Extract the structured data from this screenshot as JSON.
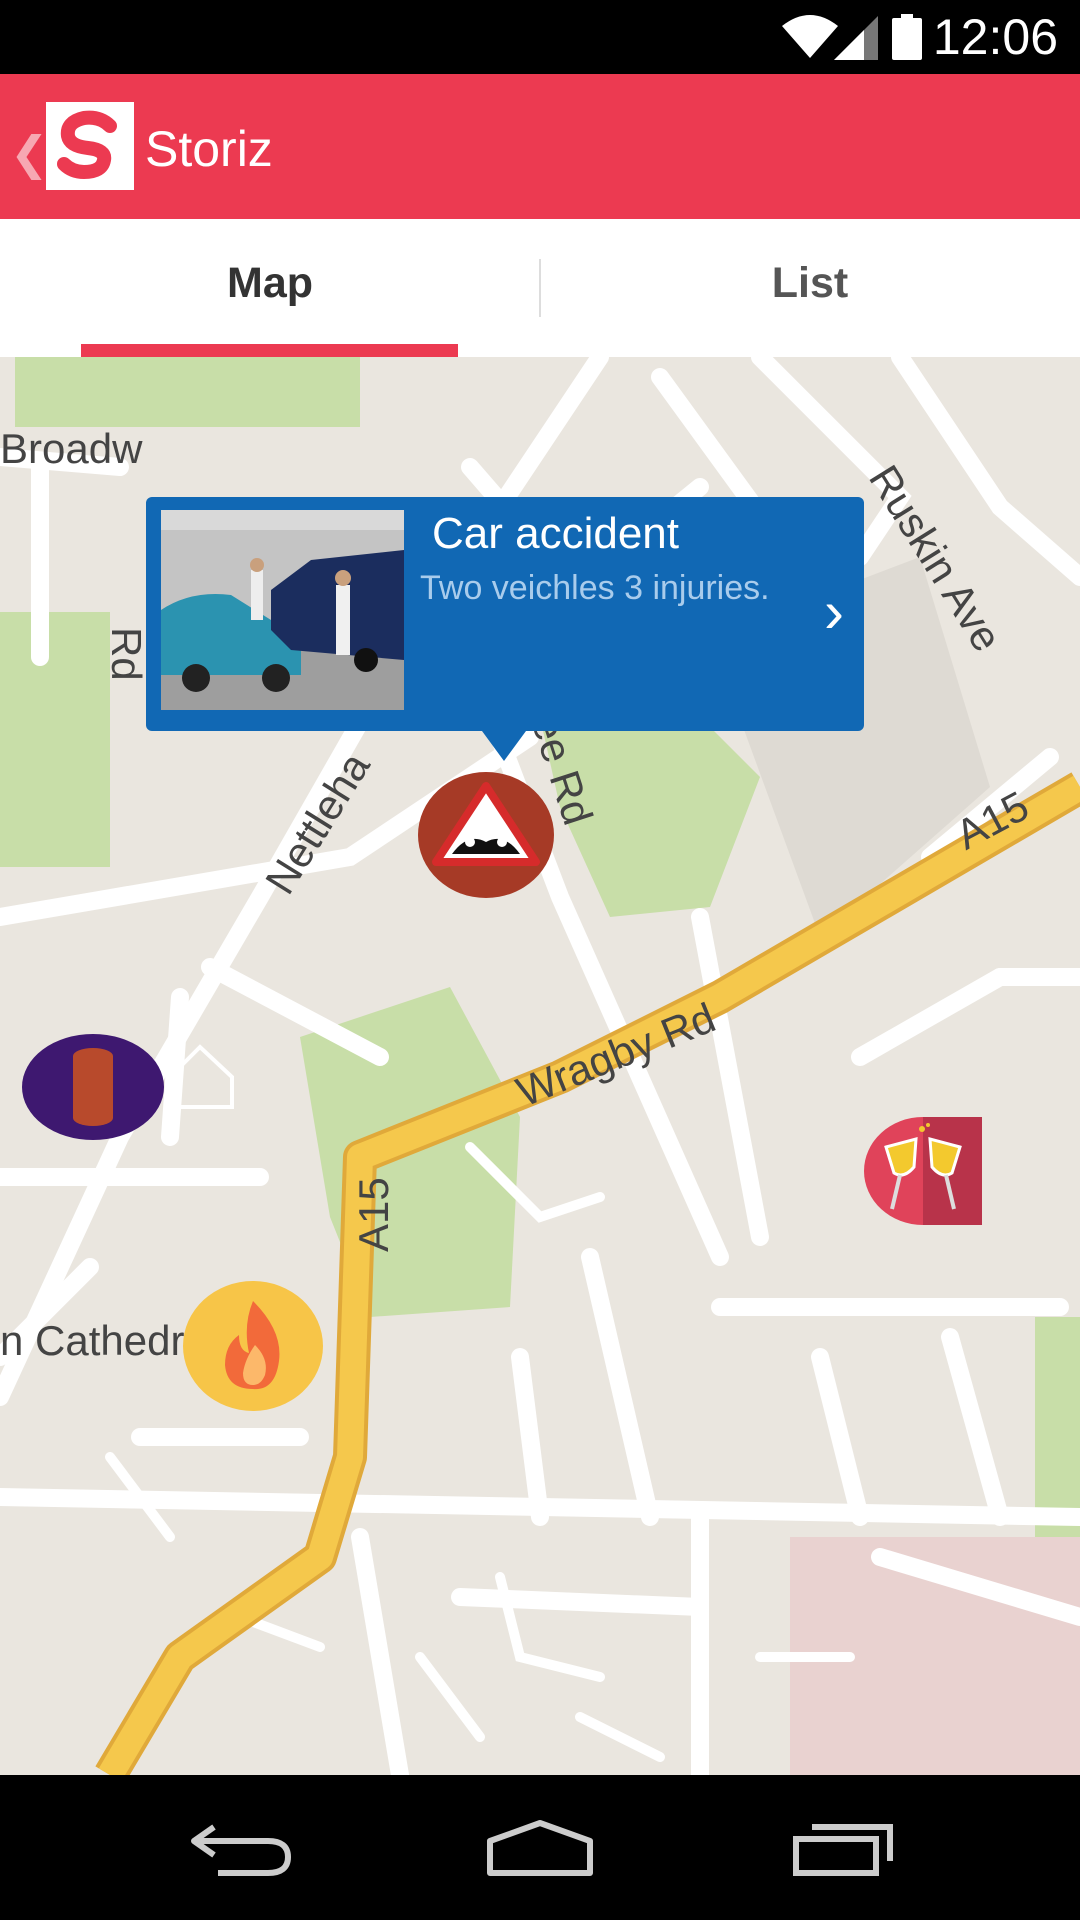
{
  "status_bar": {
    "time": "12:06"
  },
  "app_bar": {
    "title": "Storiz",
    "logo_letter": "S"
  },
  "tabs": [
    {
      "label": "Map",
      "selected": true
    },
    {
      "label": "List",
      "selected": false
    }
  ],
  "map": {
    "labels": {
      "broadway": "Broadw",
      "ruskin_ave": "Ruskin Ave",
      "rd_left": "Rd",
      "nettleham": "Nettleha",
      "lee_rd": "Lee Rd",
      "a15_right": "A15",
      "wragby_rd": "Wragby Rd",
      "a15_bottom": "A15",
      "cathedral": "n Cathedral"
    }
  },
  "callout": {
    "title": "Car accident",
    "description": "Two veichles 3 injuries."
  },
  "markers": [
    {
      "name": "car-accident-marker",
      "icon": "warning-triangle-icon",
      "color": "#a63a26"
    },
    {
      "name": "info-marker",
      "icon": "info-icon",
      "color": "#3e1870"
    },
    {
      "name": "celebration-marker",
      "icon": "champagne-glasses-icon",
      "color": "#e0435a"
    },
    {
      "name": "fire-marker",
      "icon": "fire-icon",
      "color": "#f7c548"
    }
  ],
  "colors": {
    "accent": "#ec3a51",
    "callout_bg": "#1168b4",
    "map_bg": "#eae6df",
    "park_green": "#c8dea8",
    "highway": "#f5c84c"
  }
}
